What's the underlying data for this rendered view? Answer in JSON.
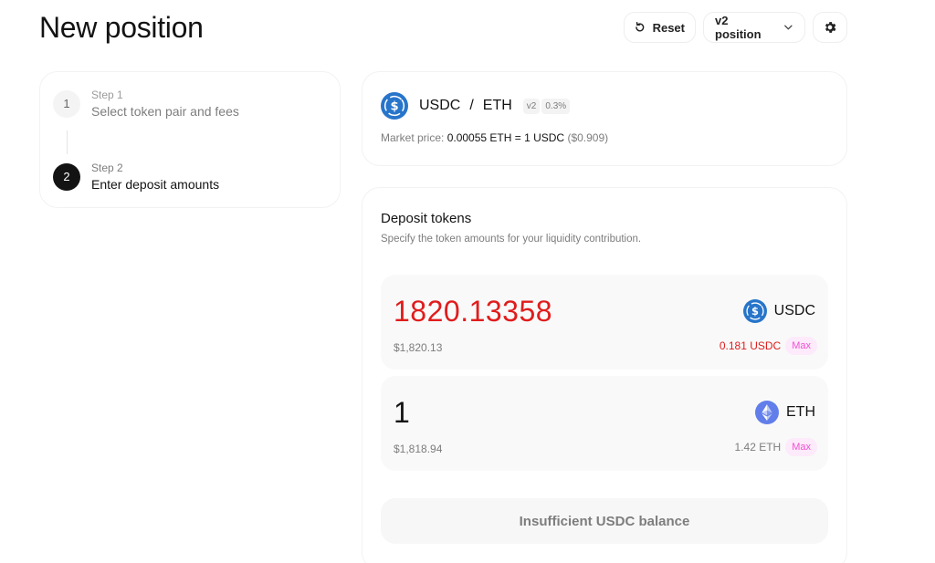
{
  "page": {
    "title": "New position"
  },
  "toolbar": {
    "reset_label": "Reset",
    "version_label": "v2 position"
  },
  "steps": [
    {
      "number": "1",
      "caption": "Step 1",
      "label": "Select token pair and fees"
    },
    {
      "number": "2",
      "caption": "Step 2",
      "label": "Enter deposit amounts"
    }
  ],
  "pair": {
    "token0": "USDC",
    "separator": "/",
    "token1": "ETH",
    "version_badge": "v2",
    "fee_badge": "0.3%",
    "market_label": "Market price:",
    "market_value": "0.00055 ETH = 1 USDC",
    "market_usd": "($0.909)"
  },
  "deposit": {
    "title": "Deposit tokens",
    "subtitle": "Specify the token amounts for your liquidity contribution.",
    "token0": {
      "amount": "1820.13358",
      "fiat": "$1,820.13",
      "symbol": "USDC",
      "balance": "0.181 USDC",
      "max_label": "Max"
    },
    "token1": {
      "amount": "1",
      "fiat": "$1,818.94",
      "symbol": "ETH",
      "balance": "1.42 ETH",
      "max_label": "Max"
    },
    "submit_label": "Insufficient USDC balance"
  },
  "colors": {
    "usdc": "#2775ca",
    "eth": "#627eea",
    "error": "#e01c1c",
    "accent": "#f050d4"
  },
  "icons": [
    "reset-icon",
    "chevron-down-icon",
    "gear-icon",
    "usdc-icon",
    "eth-icon"
  ]
}
